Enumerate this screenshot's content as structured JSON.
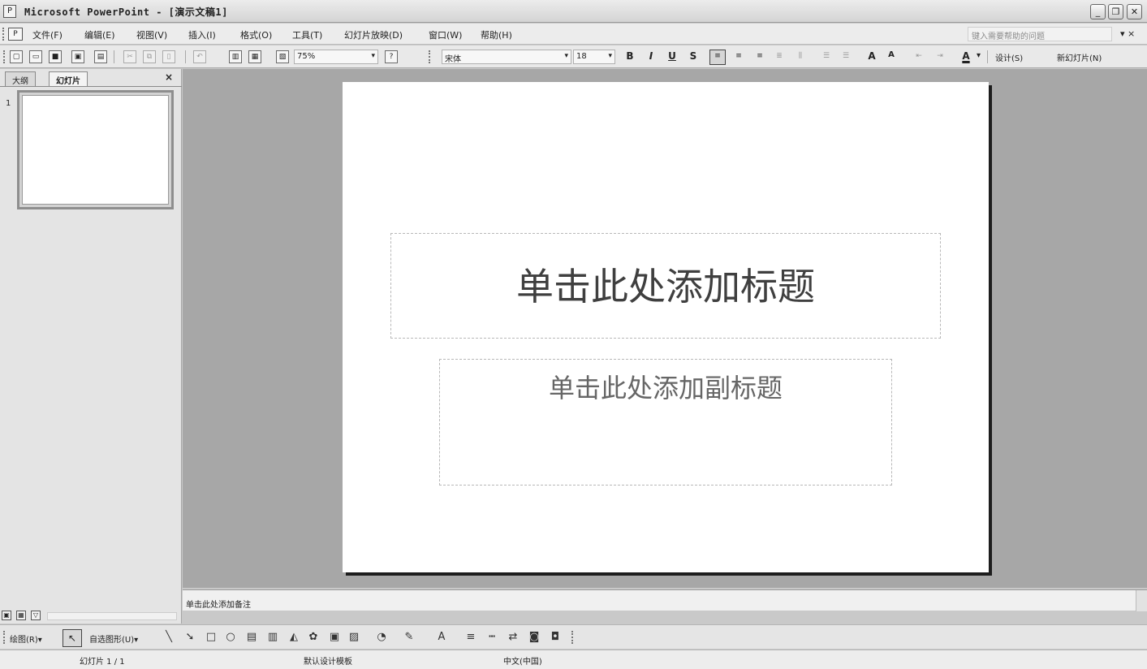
{
  "window": {
    "title": "Microsoft PowerPoint - [演示文稿1]"
  },
  "menu": {
    "items": [
      "文件(F)",
      "编辑(E)",
      "视图(V)",
      "插入(I)",
      "格式(O)",
      "工具(T)",
      "幻灯片放映(D)",
      "窗口(W)",
      "帮助(H)"
    ],
    "help_placeholder": "键入需要帮助的问题",
    "close_glyph": "▾ ×"
  },
  "toolbar": {
    "zoom": "75%",
    "font_name": "宋体",
    "font_size": "18",
    "bold": "B",
    "italic": "I",
    "underline": "U",
    "shadow": "S",
    "font_grow": "A",
    "font_shrink": "A",
    "font_color": "A",
    "design_label": "设计(S)",
    "new_slide_label": "新幻灯片(N)"
  },
  "left_pane": {
    "tab_outline": "大纲",
    "tab_slides": "幻灯片",
    "close_glyph": "×",
    "slide_number": "1"
  },
  "slide": {
    "title_placeholder": "单击此处添加标题",
    "subtitle_placeholder": "单击此处添加副标题"
  },
  "notes": {
    "placeholder": "单击此处添加备注"
  },
  "draw_toolbar": {
    "draw_label": "绘图(R)▾",
    "autoshapes_label": "自选图形(U)▾"
  },
  "status": {
    "slide_position": "幻灯片 1 / 1",
    "design_template": "默认设计模板",
    "language": "中文(中国)"
  }
}
